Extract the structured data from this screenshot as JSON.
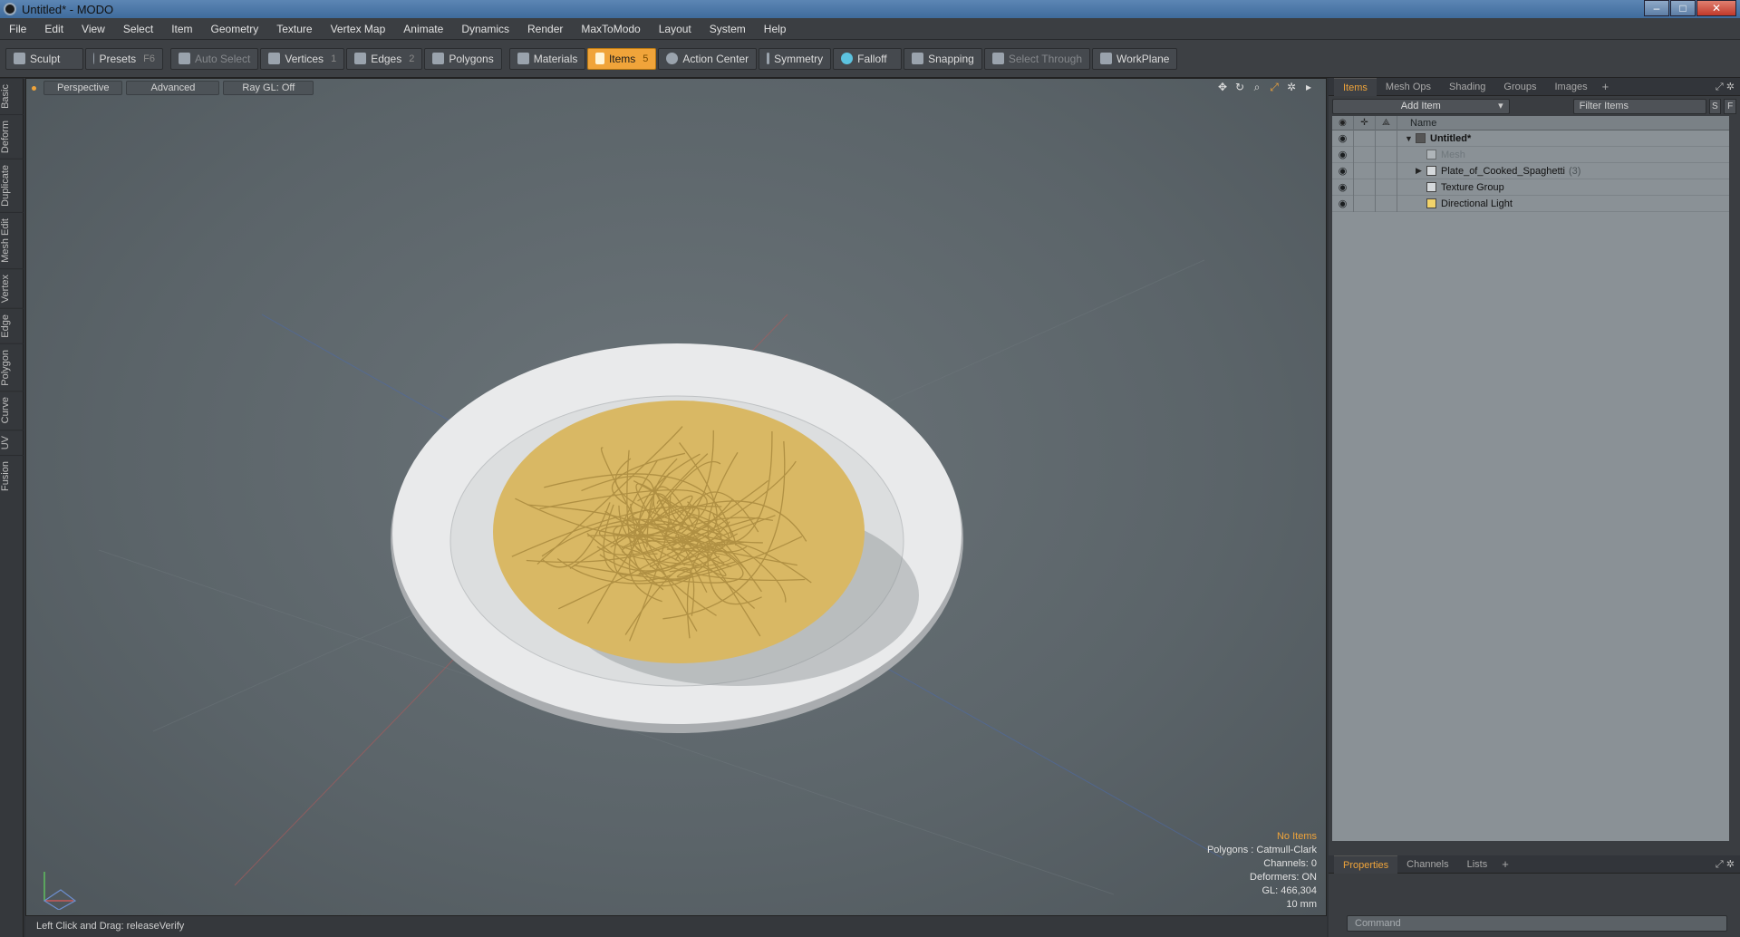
{
  "window": {
    "title": "Untitled* - MODO"
  },
  "menu": [
    "File",
    "Edit",
    "View",
    "Select",
    "Item",
    "Geometry",
    "Texture",
    "Vertex Map",
    "Animate",
    "Dynamics",
    "Render",
    "MaxToModo",
    "Layout",
    "System",
    "Help"
  ],
  "toolbar": {
    "sculpt": "Sculpt",
    "presets": "Presets",
    "presets_key": "F6",
    "auto_select": "Auto Select",
    "vertices": "Vertices",
    "vertices_key": "1",
    "edges": "Edges",
    "edges_key": "2",
    "polygons": "Polygons",
    "materials": "Materials",
    "items": "Items",
    "items_key": "5",
    "action_center": "Action Center",
    "symmetry": "Symmetry",
    "falloff": "Falloff",
    "snapping": "Snapping",
    "select_through": "Select Through",
    "workplane": "WorkPlane"
  },
  "left_tabs": [
    "Basic",
    "Deform",
    "Duplicate",
    "Mesh Edit",
    "Vertex",
    "Edge",
    "Polygon",
    "Curve",
    "UV",
    "Fusion"
  ],
  "viewport": {
    "view": "Perspective",
    "style": "Advanced",
    "raygl": "Ray GL: Off",
    "info": {
      "selection": "No Items",
      "polygons": "Polygons : Catmull-Clark",
      "channels": "Channels: 0",
      "deformers": "Deformers: ON",
      "gl": "GL: 466,304",
      "scale": "10 mm"
    },
    "colors": {
      "plate": "#e9eaeb",
      "pasta": "#d9b864",
      "background": "#5f686d"
    }
  },
  "status": {
    "text": "Left Click and Drag:   releaseVerify"
  },
  "panel": {
    "tabs": [
      "Items",
      "Mesh Ops",
      "Shading",
      "Groups",
      "Images"
    ],
    "add_item": "Add Item",
    "filter": "Filter Items",
    "filter_s": "S",
    "filter_f": "F",
    "name_header": "Name",
    "items": [
      {
        "label": "Untitled*",
        "count": ""
      },
      {
        "label": "Mesh",
        "count": ""
      },
      {
        "label": "Plate_of_Cooked_Spaghetti",
        "count": "(3)"
      },
      {
        "label": "Texture Group",
        "count": ""
      },
      {
        "label": "Directional Light",
        "count": ""
      }
    ],
    "bottom_tabs": [
      "Properties",
      "Channels",
      "Lists"
    ],
    "command": "Command"
  }
}
